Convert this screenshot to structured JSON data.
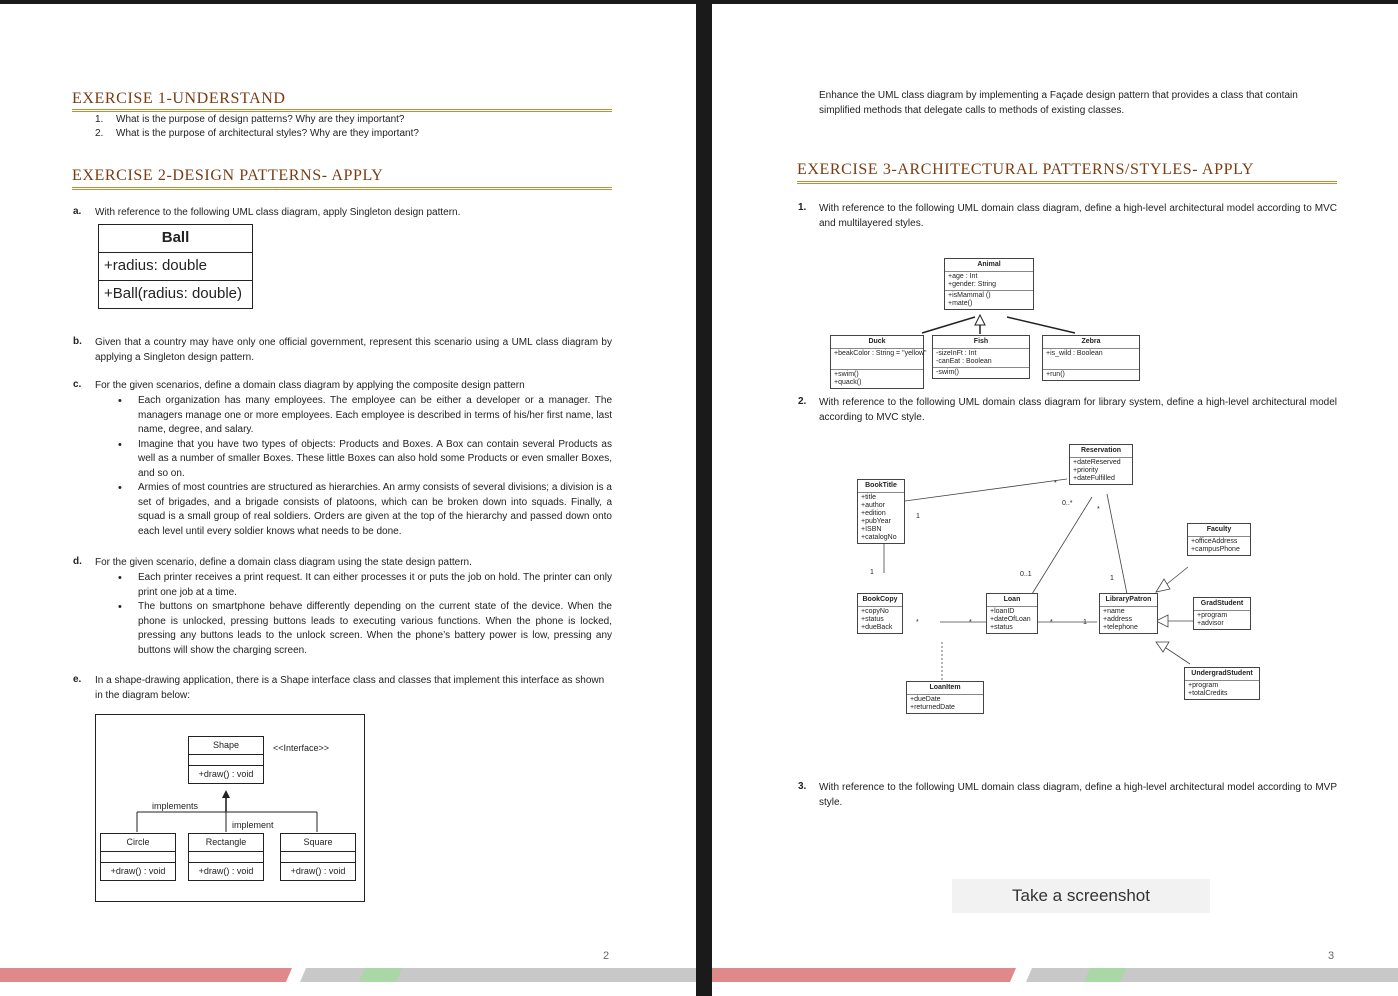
{
  "left_page": {
    "ex1": {
      "heading": "EXERCISE 1-UNDERSTAND",
      "items": [
        {
          "num": "1.",
          "text": "What is the purpose of design patterns? Why are they important?"
        },
        {
          "num": "2.",
          "text": "What is the purpose of architectural styles? Why are they important?"
        }
      ]
    },
    "ex2": {
      "heading": "EXERCISE 2-DESIGN PATTERNS- APPLY",
      "a": {
        "label": "a.",
        "text": "With reference to the following UML class diagram, apply Singleton design pattern."
      },
      "ball": {
        "name": "Ball",
        "attr": "+radius: double",
        "method": "+Ball(radius: double)"
      },
      "b": {
        "label": "b.",
        "text": "Given that a country may have only one official government, represent this scenario using a UML class diagram by applying a Singleton design pattern."
      },
      "c": {
        "label": "c.",
        "text": "For the given scenarios, define a domain class diagram by applying the composite design pattern",
        "bullets": [
          "Each organization has many employees. The employee can be either a developer or a manager. The managers manage one or more employees. Each employee is described in terms of his/her first name, last name, degree, and salary.",
          "Imagine that you have two types of objects: Products and Boxes. A Box can contain several Products as well as a number of smaller Boxes. These little Boxes can also hold some Products or even smaller Boxes, and so on.",
          "Armies of most countries are structured as hierarchies. An army consists of several divisions; a division is a set of brigades, and a brigade consists of platoons, which can be broken down into squads. Finally, a squad is a small group of real soldiers. Orders are given at the top of the hierarchy and passed down onto each level until every soldier knows what needs to be done."
        ]
      },
      "d": {
        "label": "d.",
        "text": "For the given scenario, define a domain class diagram using the state design pattern.",
        "bullets": [
          "Each printer receives a print request. It can either processes it or puts the job on hold. The printer can only print one job at a time.",
          "The buttons on smartphone behave differently depending on the current state of the device. When the phone is unlocked, pressing buttons leads to executing various functions. When the phone is locked, pressing any buttons leads to the unlock screen. When the phone’s battery power is low, pressing any buttons will show the charging screen."
        ]
      },
      "e": {
        "label": "e.",
        "text": "In a shape-drawing application, there is a Shape interface class and classes that implement this interface as shown in the diagram below:"
      },
      "shape_diagram": {
        "shape": {
          "name": "Shape",
          "method": "+draw() : void"
        },
        "stereotype": "<<Interface>>",
        "implements": "implements",
        "implement": "implement",
        "circle": {
          "name": "Circle",
          "method": "+draw() : void"
        },
        "rectangle": {
          "name": "Rectangle",
          "method": "+draw() : void"
        },
        "square": {
          "name": "Square",
          "method": "+draw() : void"
        }
      }
    },
    "page_number": "2"
  },
  "right_page": {
    "intro": "Enhance the UML class diagram by implementing a Façade design pattern that provides a class that contain simplified methods that delegate calls to methods of existing classes.",
    "ex3": {
      "heading": "EXERCISE 3-ARCHITECTURAL PATTERNS/STYLES- APPLY",
      "q1": {
        "num": "1.",
        "text": "With reference to the following UML domain class diagram, define a high-level architectural model according to MVC and multilayered styles."
      },
      "q2": {
        "num": "2.",
        "text": "With reference to the following UML domain class diagram for library system, define a high-level architectural model according to MVC style."
      },
      "q3": {
        "num": "3.",
        "text": "With reference to the following UML domain class diagram, define a high-level architectural model according to MVP style."
      }
    },
    "animal_diagram": {
      "animal": {
        "name": "Animal",
        "attrs": "+age : Int\n+gender: String",
        "methods": "+isMammal ()\n+mate()"
      },
      "duck": {
        "name": "Duck",
        "attrs": "+beakColor : String = \"yellow\"",
        "methods": "+swim()\n+quack()"
      },
      "fish": {
        "name": "Fish",
        "attrs": "-sizeInFt : Int\n-canEat : Boolean",
        "methods": "-swim()"
      },
      "zebra": {
        "name": "Zebra",
        "attrs": "+is_wild : Boolean",
        "methods": "+run()"
      }
    },
    "library_diagram": {
      "reservation": {
        "name": "Reservation",
        "attrs": "+dateReserved\n+priority\n+dateFulfilled"
      },
      "booktitle": {
        "name": "BookTitle",
        "attrs": "+title\n+author\n+edition\n+pubYear\n+ISBN\n+catalogNo"
      },
      "faculty": {
        "name": "Faculty",
        "attrs": "+officeAddress\n+campusPhone"
      },
      "bookcopy": {
        "name": "BookCopy",
        "attrs": "+copyNo\n+status\n+dueBack"
      },
      "loan": {
        "name": "Loan",
        "attrs": "+loanID\n+dateOfLoan\n+status"
      },
      "patron": {
        "name": "LibraryPatron",
        "attrs": "+name\n+address\n+telephone"
      },
      "grad": {
        "name": "GradStudent",
        "attrs": "+program\n+advisor"
      },
      "undergrad": {
        "name": "UndergradStudent",
        "attrs": "+program\n+totalCredits"
      },
      "loanitem": {
        "name": "LoanItem",
        "attrs": "+dueDate\n+returnedDate"
      },
      "mult": {
        "one": "1",
        "star": "*",
        "zero_many": "0..*",
        "zero_one": "0..1"
      }
    },
    "screenshot_button": "Take a screenshot",
    "page_number": "3"
  },
  "colors": {
    "heading": "#7b3b10",
    "rule": "#c58b36",
    "footer_red": "#e0898b",
    "footer_gray": "#c8c8c8",
    "footer_green": "#a9d7a6"
  }
}
